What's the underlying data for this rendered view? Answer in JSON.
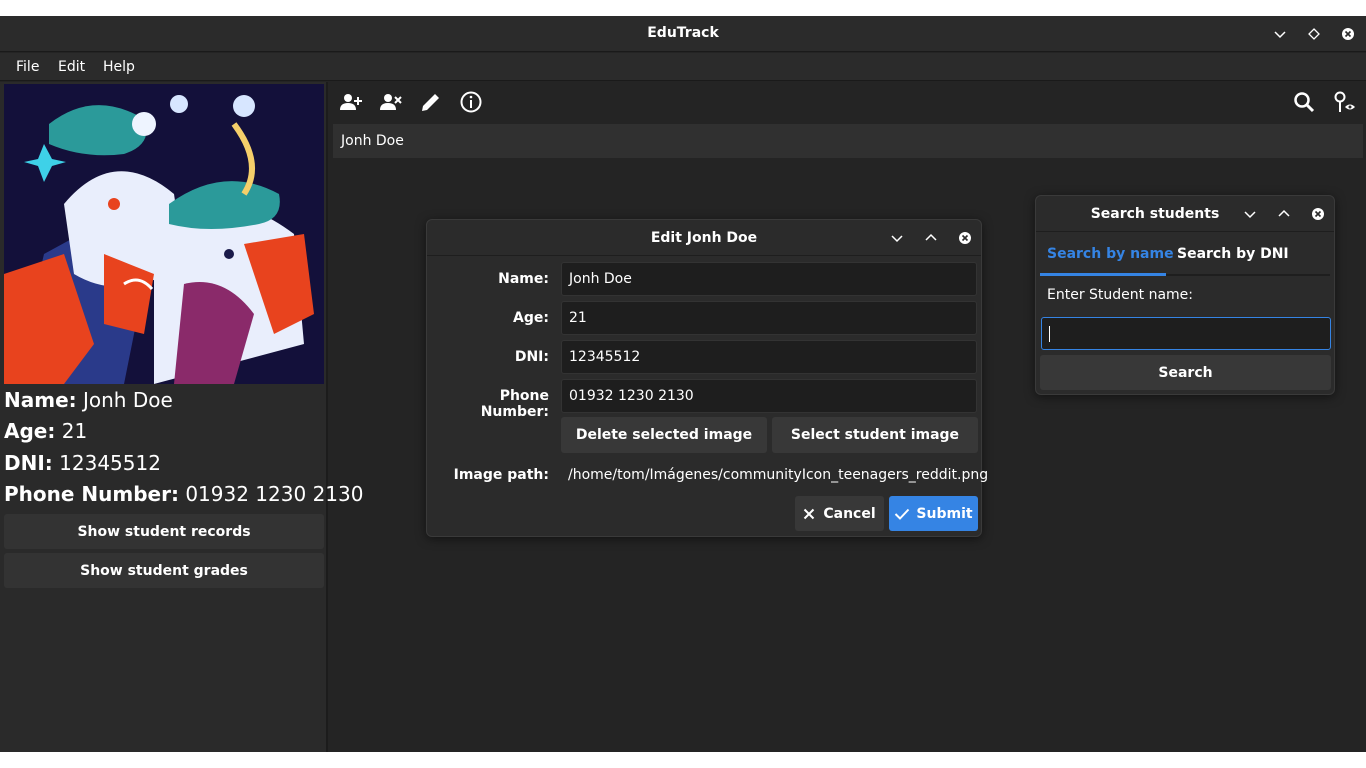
{
  "window": {
    "title": "EduTrack"
  },
  "menu": {
    "file": "File",
    "edit": "Edit",
    "help": "Help"
  },
  "student": {
    "name_label": "Name:",
    "name": "Jonh Doe",
    "age_label": "Age:",
    "age": "21",
    "dni_label": "DNI:",
    "dni": "12345512",
    "phone_label": "Phone Number:",
    "phone": "01932 1230 2130",
    "records_button": "Show student records",
    "grades_button": "Show student grades"
  },
  "selected_name": "Jonh Doe",
  "edit_dialog": {
    "title": "Edit Jonh Doe",
    "name_label": "Name:",
    "name_value": "Jonh Doe",
    "age_label": "Age:",
    "age_value": "21",
    "dni_label": "DNI:",
    "dni_value": "12345512",
    "phone_label": "Phone Number:",
    "phone_value": "01932 1230 2130",
    "delete_image": "Delete selected image",
    "select_image": "Select student image",
    "image_path_label": "Image path:",
    "image_path": "/home/tom/Imágenes/communityIcon_teenagers_reddit.png",
    "cancel": "Cancel",
    "submit": "Submit"
  },
  "search_dialog": {
    "title": "Search students",
    "tab_name": "Search by name",
    "tab_dni": "Search by DNI",
    "prompt": "Enter Student name:",
    "input_value": "",
    "search_button": "Search"
  },
  "colors": {
    "accent": "#3584e4",
    "background": "#242424",
    "panel": "#2a2a2a"
  }
}
